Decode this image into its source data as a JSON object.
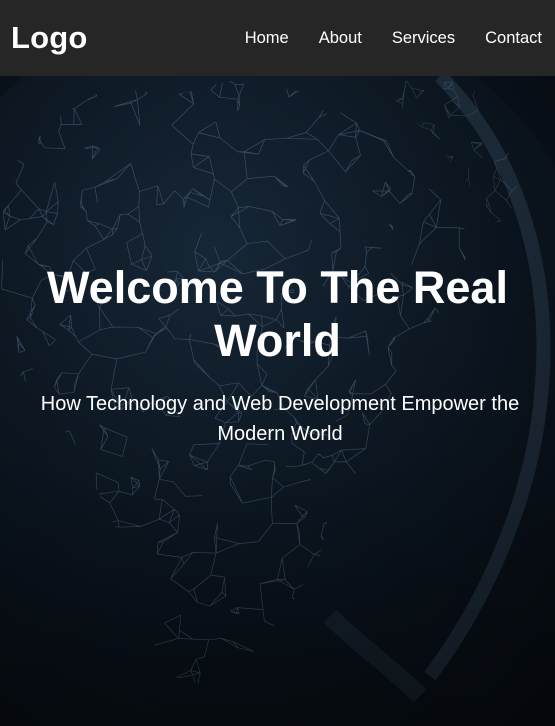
{
  "header": {
    "logo": "Logo",
    "nav": [
      {
        "label": "Home"
      },
      {
        "label": "About"
      },
      {
        "label": "Services"
      },
      {
        "label": "Contact"
      }
    ]
  },
  "hero": {
    "title": "Welcome To The Real World",
    "subtitle": "How Technology and Web Development Empower the Modern World",
    "background_image": "network-world-map"
  },
  "colors": {
    "header_bg": "#262626",
    "hero_bg": "#0b1118",
    "text": "#ffffff",
    "network": "#6f8fb0"
  }
}
